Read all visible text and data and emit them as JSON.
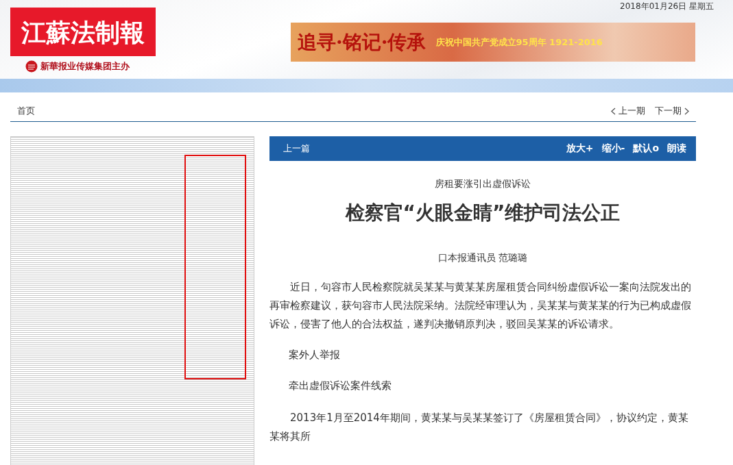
{
  "header": {
    "logo": "江蘇法制報",
    "publisher": "新華报业传媒集团主办",
    "date": "2018年01月26日 星期五",
    "banner": {
      "slogan": "追寻·铭记·传承",
      "caption": "庆祝中国共产党成立95周年 1921-2016"
    }
  },
  "nav": {
    "home": "首页",
    "prev_issue": "上一期",
    "next_issue": "下一期"
  },
  "article_toolbar": {
    "prev_article": "上一篇",
    "actions": [
      "放大+",
      "缩小-",
      "默认o",
      "朗读"
    ]
  },
  "article": {
    "subtitle": "房租要涨引出虚假诉讼",
    "title": "检察官“火眼金睛”维护司法公正",
    "byline": "口本报通讯员 范璐璐",
    "paragraphs": [
      {
        "kind": "body",
        "text": "近日，句容市人民检察院就吴某某与黄某某房屋租赁合同纠纷虚假诉讼一案向法院发出的再审检察建议，获句容市人民法院采纳。法院经审理认为，吴某某与黄某某的行为已构成虚假诉讼，侵害了他人的合法权益，遂判决撤销原判决，驳回吴某某的诉讼请求。"
      },
      {
        "kind": "heading",
        "text": "案外人举报"
      },
      {
        "kind": "heading",
        "text": "牵出虚假诉讼案件线索"
      },
      {
        "kind": "body",
        "text": "2013年1月至2014年期间，黄某某与吴某某签订了《房屋租赁合同》，协议约定，黄某某将其所"
      }
    ]
  }
}
